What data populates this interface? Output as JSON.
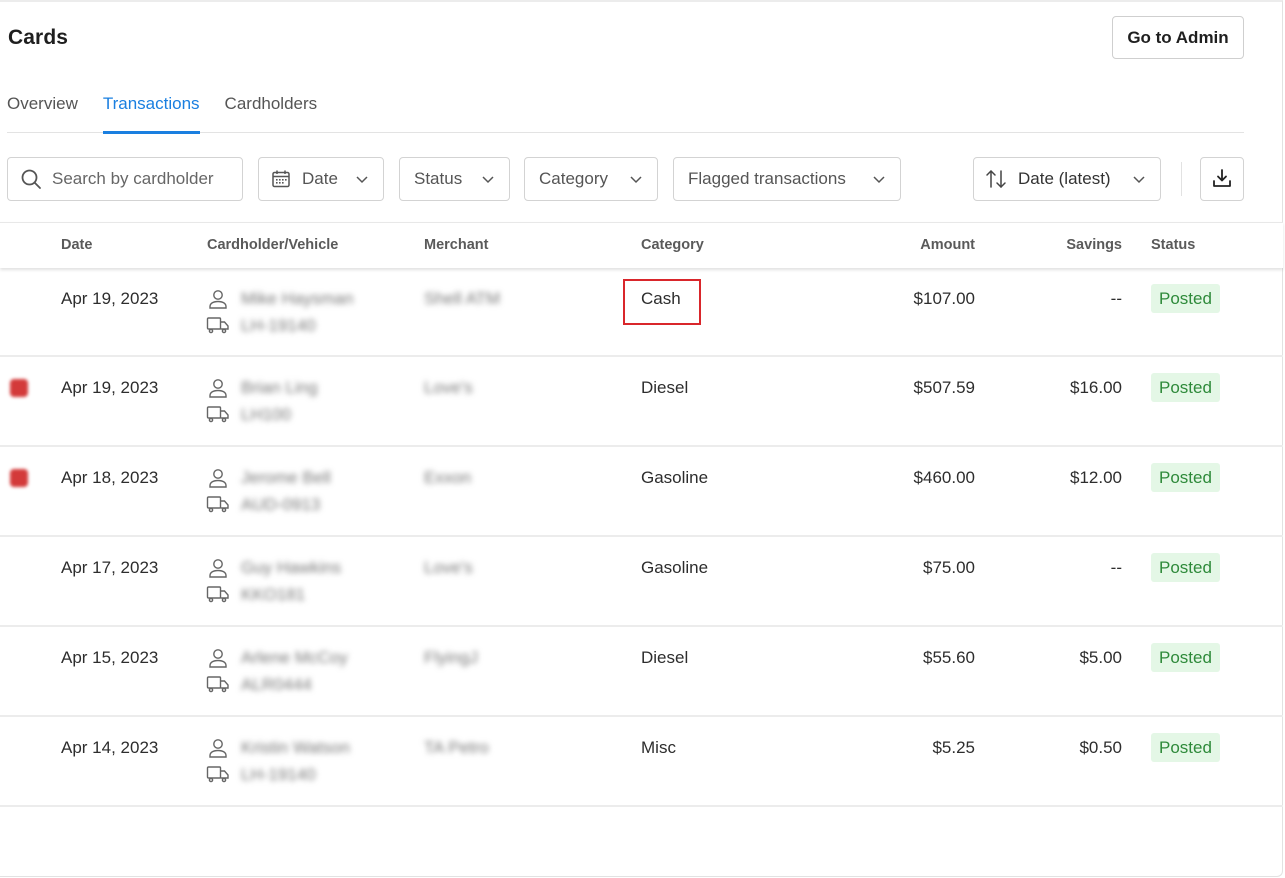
{
  "header": {
    "title": "Cards",
    "admin_button": "Go to Admin"
  },
  "tabs": [
    {
      "label": "Overview",
      "active": false
    },
    {
      "label": "Transactions",
      "active": true
    },
    {
      "label": "Cardholders",
      "active": false
    }
  ],
  "filters": {
    "search_placeholder": "Search by cardholder",
    "search_value": "",
    "date": "Date",
    "status": "Status",
    "category": "Category",
    "flagged": "Flagged transactions",
    "sort": "Date (latest)"
  },
  "icons": {
    "search": "search-icon",
    "calendar": "calendar-icon",
    "chevron": "chevron-down-icon",
    "sort": "sort-arrows-icon",
    "download": "download-icon",
    "person": "person-icon",
    "truck": "truck-icon",
    "flag": "flag-badge-icon"
  },
  "colors": {
    "accent": "#1a7fe0",
    "posted_bg": "#e4f7e6",
    "posted_text": "#2e8a3a",
    "flag": "#d33a3a",
    "highlight": "#d9262b"
  },
  "table": {
    "columns": [
      "Date",
      "Cardholder/Vehicle",
      "Merchant",
      "Category",
      "Amount",
      "Savings",
      "Status"
    ],
    "rows": [
      {
        "flagged": false,
        "date": "Apr 19, 2023",
        "cardholder": "Mike Haysman",
        "vehicle": "LH-19140",
        "merchant": "Shell ATM",
        "category": "Cash",
        "amount": "$107.00",
        "savings": "--",
        "status": "Posted",
        "highlighted_category": true
      },
      {
        "flagged": true,
        "date": "Apr 19, 2023",
        "cardholder": "Brian Ling",
        "vehicle": "LH100",
        "merchant": "Love's",
        "category": "Diesel",
        "amount": "$507.59",
        "savings": "$16.00",
        "status": "Posted"
      },
      {
        "flagged": true,
        "date": "Apr 18, 2023",
        "cardholder": "Jerome Bell",
        "vehicle": "AUD-0913",
        "merchant": "Exxon",
        "category": "Gasoline",
        "amount": "$460.00",
        "savings": "$12.00",
        "status": "Posted"
      },
      {
        "flagged": false,
        "date": "Apr 17, 2023",
        "cardholder": "Guy Hawkins",
        "vehicle": "KKO181",
        "merchant": "Love's",
        "category": "Gasoline",
        "amount": "$75.00",
        "savings": "--",
        "status": "Posted"
      },
      {
        "flagged": false,
        "date": "Apr 15, 2023",
        "cardholder": "Arlene McCoy",
        "vehicle": "ALR0444",
        "merchant": "FlyingJ",
        "category": "Diesel",
        "amount": "$55.60",
        "savings": "$5.00",
        "status": "Posted"
      },
      {
        "flagged": false,
        "date": "Apr 14, 2023",
        "cardholder": "Kristin Watson",
        "vehicle": "LH-19140",
        "merchant": "TA Petro",
        "category": "Misc",
        "amount": "$5.25",
        "savings": "$0.50",
        "status": "Posted"
      }
    ]
  }
}
